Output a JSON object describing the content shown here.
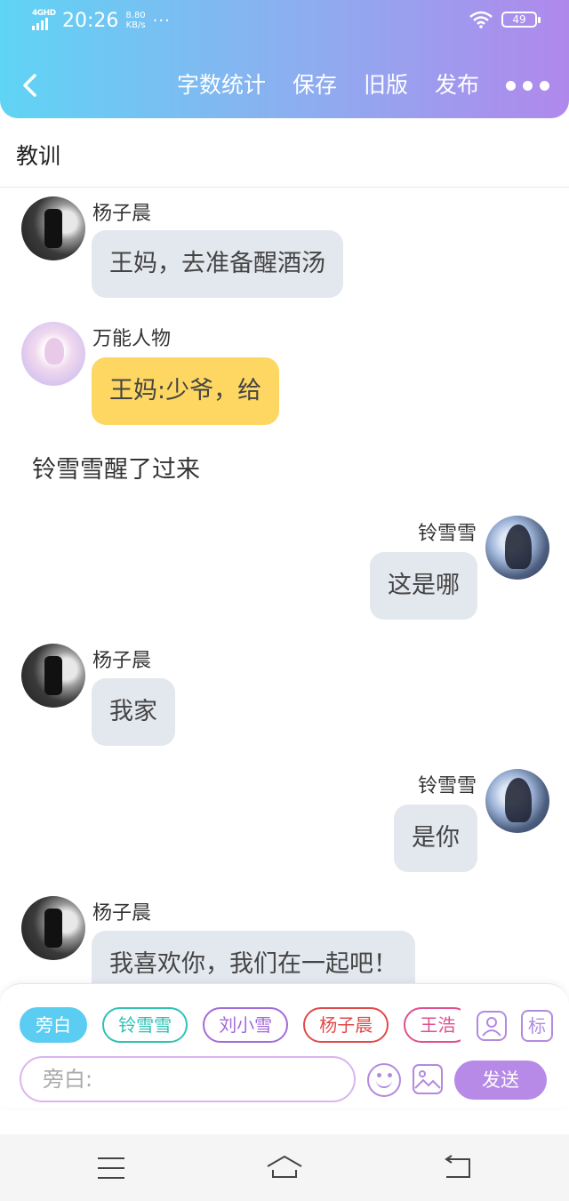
{
  "status_bar": {
    "network": "4GHD",
    "time": "20:26",
    "speed_value": "8.80",
    "speed_unit": "KB/s",
    "more_dots": "···",
    "battery": "49"
  },
  "nav": {
    "actions": [
      "字数统计",
      "保存",
      "旧版",
      "发布"
    ]
  },
  "document": {
    "title": "教训"
  },
  "messages": [
    {
      "sender": "杨子晨",
      "text": "王妈，去准备醒酒汤",
      "side": "left",
      "avatar": "dark",
      "color": "#e3e7ee"
    },
    {
      "sender": "万能人物",
      "text": "王妈:少爷，给",
      "side": "left",
      "avatar": "pink",
      "color": "#fdd762"
    },
    {
      "narration": "铃雪雪醒了过来"
    },
    {
      "sender": "铃雪雪",
      "text": "这是哪",
      "side": "right",
      "avatar": "blue",
      "color": "#e3e7ee"
    },
    {
      "sender": "杨子晨",
      "text": "我家",
      "side": "left",
      "avatar": "dark",
      "color": "#e3e7ee"
    },
    {
      "sender": "铃雪雪",
      "text": "是你",
      "side": "right",
      "avatar": "blue",
      "color": "#e3e7ee"
    },
    {
      "sender": "杨子晨",
      "text": "我喜欢你，我们在一起吧！",
      "side": "left",
      "avatar": "dark",
      "color": "#e3e7ee"
    }
  ],
  "composer": {
    "characters": [
      {
        "name": "旁白",
        "color": "#5ccdf2",
        "active": true
      },
      {
        "name": "铃雪雪",
        "color": "#2fc1b6"
      },
      {
        "name": "刘小雪",
        "color": "#a36bd8"
      },
      {
        "name": "杨子晨",
        "color": "#e04a4a"
      },
      {
        "name": "王浩",
        "color": "#e0508c"
      }
    ],
    "mark_label": "标",
    "input_placeholder": "旁白:",
    "send_label": "发送"
  }
}
